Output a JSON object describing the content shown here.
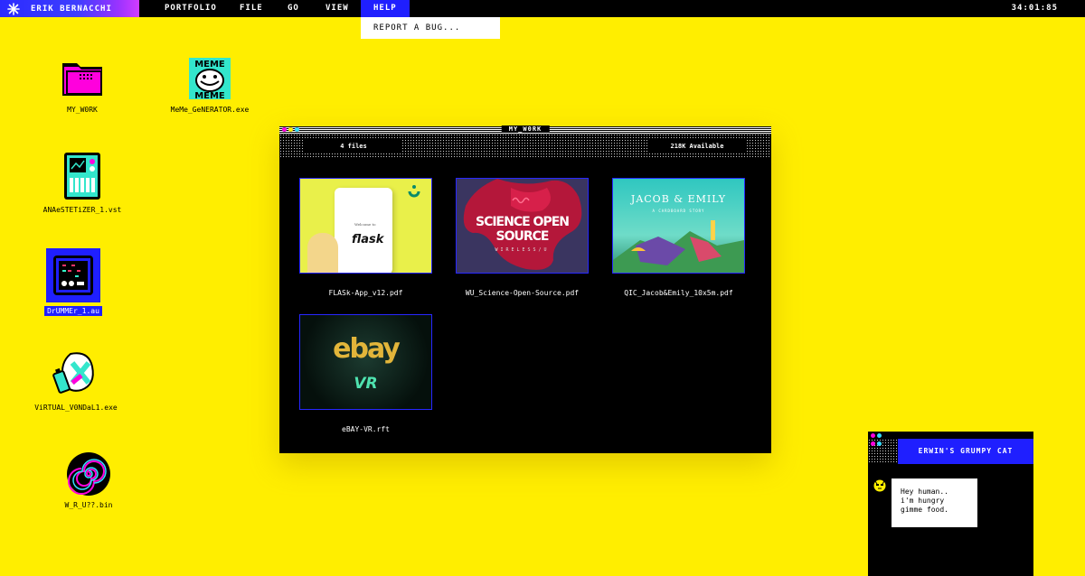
{
  "menubar": {
    "brand": "ERIK BERNACCHI",
    "items": [
      "PORTFOLIO",
      "FILE",
      "GO",
      "VIEW",
      "HELP"
    ],
    "clock": "34:01:85"
  },
  "dropdown": {
    "item": "REPORT A BUG..."
  },
  "desktop": {
    "icons": [
      {
        "label": "MY_W0RK",
        "icon": "folder-icon"
      },
      {
        "label": "MeMe_GeNERATOR.exe",
        "icon": "meme-icon"
      },
      {
        "label": "ANAeSTETiZER_1.vst",
        "icon": "synth-icon"
      },
      {
        "label": "DrUMMEr_1.au",
        "icon": "drum-machine-icon"
      },
      {
        "label": "ViRTUAL_V0NDaL1.exe",
        "icon": "spray-can-icon"
      },
      {
        "label": "W_R_U??.bin",
        "icon": "spiral-icon"
      }
    ]
  },
  "window": {
    "title": "MY_W0RK",
    "files_count": "4 files",
    "available": "218K Available",
    "files": [
      {
        "name": "FLASk-App_v12.pdf",
        "thumb_text": "flask",
        "thumb_sub": "Welcome to"
      },
      {
        "name": "WU_Science-Open-Source.pdf",
        "thumb_text": "SCIENCE OPEN SOURCE",
        "thumb_sub": "WIRELESS/U"
      },
      {
        "name": "QIC_Jacob&Emily_10x5m.pdf",
        "thumb_text": "JACOB & EMILY",
        "thumb_sub": "A CARDBOARD STORY"
      },
      {
        "name": "eBAY-VR.rft",
        "thumb_text": "ebay",
        "thumb_sub": "VR"
      }
    ]
  },
  "chat": {
    "title": "ERWIN'S GRUMPY CAT",
    "lines": [
      "Hey human..",
      "i'm hungry",
      "gimme food."
    ]
  },
  "colors": {
    "background": "#ffee00",
    "accent": "#1f1fff",
    "magenta": "#ff00dd",
    "dot_yellow": "#ffee00",
    "dot_cyan": "#33ddff"
  }
}
